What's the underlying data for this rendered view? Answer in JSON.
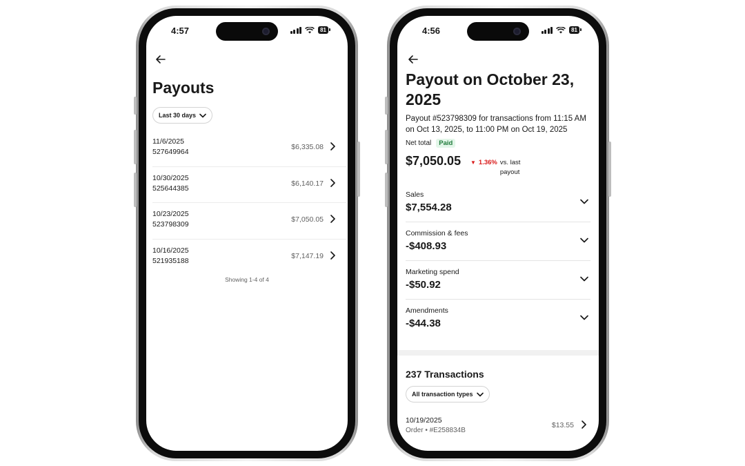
{
  "left_screen": {
    "status": {
      "time": "4:57",
      "battery": "81"
    },
    "title": "Payouts",
    "filter_label": "Last 30 days",
    "payouts": [
      {
        "date": "11/6/2025",
        "id": "527649964",
        "amount": "$6,335.08"
      },
      {
        "date": "10/30/2025",
        "id": "525644385",
        "amount": "$6,140.17"
      },
      {
        "date": "10/23/2025",
        "id": "523798309",
        "amount": "$7,050.05"
      },
      {
        "date": "10/16/2025",
        "id": "521935188",
        "amount": "$7,147.19"
      }
    ],
    "showing": "Showing 1-4 of 4"
  },
  "right_screen": {
    "status": {
      "time": "4:56",
      "battery": "81"
    },
    "title": "Payout on October 23, 2025",
    "description": "Payout #523798309 for transactions from 11:15 AM on Oct 13, 2025, to 11:00 PM on Oct 19, 2025",
    "net_total_label": "Net total",
    "paid_badge": "Paid",
    "net_amount": "$7,050.05",
    "delta_percent": "1.36%",
    "delta_suffix": "vs. last payout",
    "breakdown": [
      {
        "label": "Sales",
        "value": "$7,554.28"
      },
      {
        "label": "Commission & fees",
        "value": "-$408.93"
      },
      {
        "label": "Marketing spend",
        "value": "-$50.92"
      },
      {
        "label": "Amendments",
        "value": "-$44.38"
      }
    ],
    "transactions_count": "237 Transactions",
    "transactions_filter": "All transaction types",
    "transaction": {
      "date": "10/19/2025",
      "subtitle": "Order • #E258834B",
      "amount": "$13.55"
    }
  },
  "colors": {
    "negative": "#d91a1a",
    "paid_bg": "#e3f6e9",
    "paid_text": "#1f7a3a"
  }
}
